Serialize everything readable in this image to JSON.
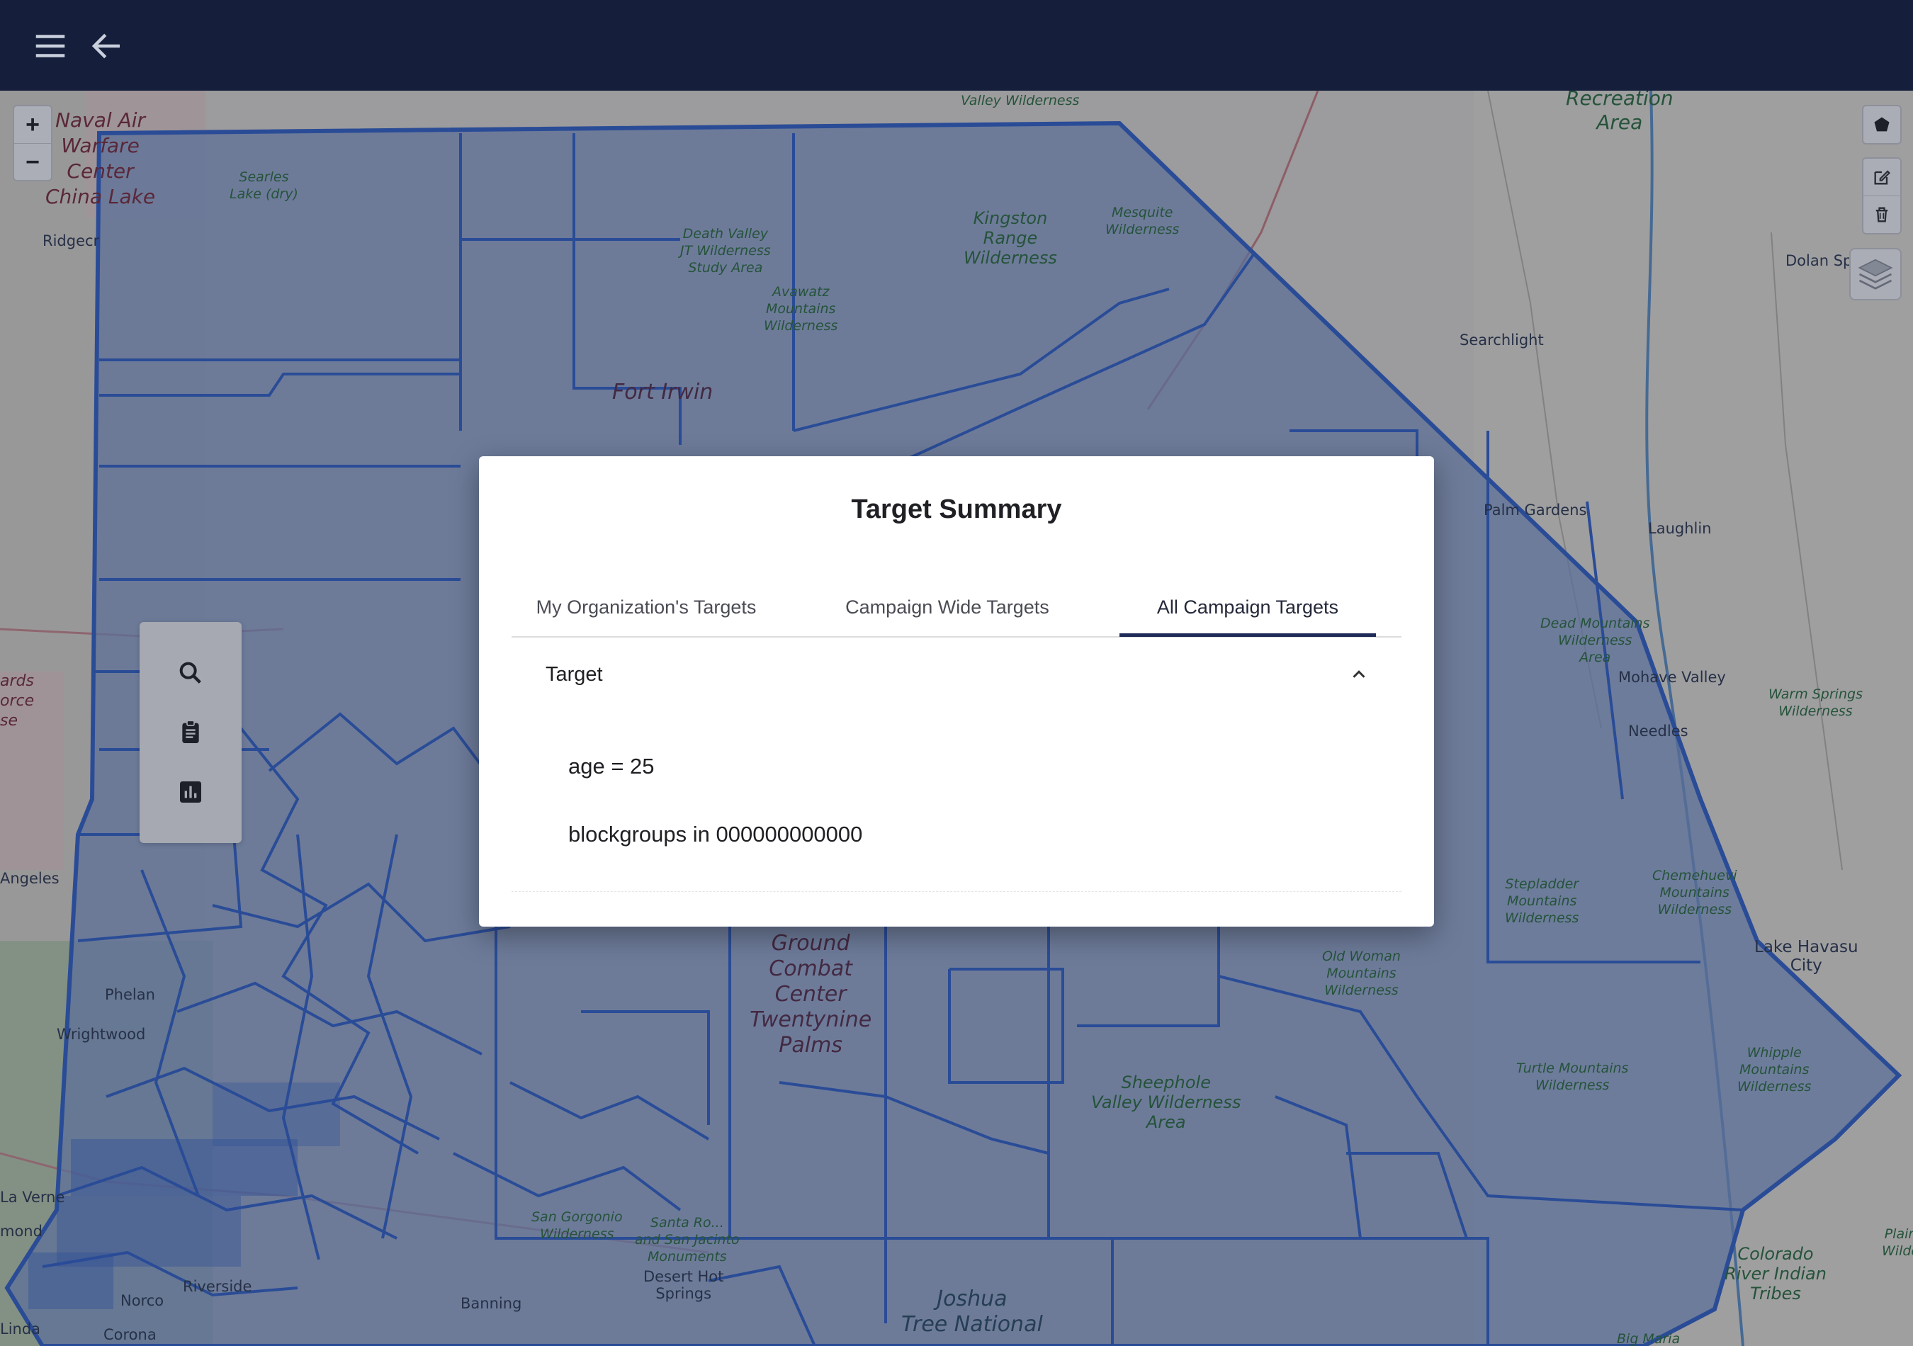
{
  "header": {
    "menu_icon": "menu-icon",
    "back_icon": "arrow-left-icon",
    "background": "#151f3b"
  },
  "map": {
    "labels": {
      "naval_air": "Naval Air\nWarfare\nCenter\nChina Lake",
      "searles": "Searles\nLake (dry)",
      "ridgecrest": "Ridgecr",
      "death_valley": "Death Valley\nJT Wilderness\nStudy Area",
      "avawatz": "Avawatz\nMountains\nWilderness",
      "kingston": "Kingston\nRange\nWilderness",
      "mesquite": "Mesquite\nWilderness",
      "valley_wilderness": "Valley Wilderness",
      "recreation_area": "Recreation\nArea",
      "fort_irwin": "Fort Irwin",
      "searchlight": "Searchlight",
      "dolan_springs": "Dolan Spr",
      "palm_gardens": "Palm Gardens",
      "laughlin": "Laughlin",
      "dead_mountains": "Dead Mountains\nWilderness\nArea",
      "mojave_valley": "Mohave Valley",
      "warm_springs": "Warm Springs\nWilderness",
      "needles": "Needles",
      "stepladder": "Stepladder\nMountains\nWilderness",
      "chemehuevi": "Chemehuevi\nMountains\nWilderness",
      "old_woman": "Old Woman\nMountains\nWilderness",
      "lake_havasu": "Lake Havasu\nCity",
      "ground_combat": "Ground\nCombat\nCenter\nTwentynine\nPalms",
      "turtle": "Turtle Mountains\nWilderness",
      "whipple": "Whipple\nMountains\nWilderness",
      "sheephole": "Sheephole\nValley Wilderness\nArea",
      "angeles": "Angeles",
      "rds_orce": "ards\norce\nse",
      "phelan": "Phelan",
      "wrightwood": "Wrightwood",
      "la_verne": "La Verne",
      "mond": "mond",
      "riverside": "Riverside",
      "norco": "Norco",
      "corona": "Corona",
      "linda": "Linda",
      "banning": "Banning",
      "desert_hot": "Desert Hot\nSprings",
      "san_gorgonio": "San Gorgonio\nWilderness",
      "santa_rosa": "Santa Ro...\nand San Jacinto\nMonuments",
      "joshua_tree": "Joshua\nTree National",
      "colorado_river": "Colorado\nRiver Indian\nTribes",
      "big_maria": "Big Maria",
      "plain": "Plain\nWilde"
    }
  },
  "map_controls": {
    "zoom_in": "+",
    "zoom_out": "−",
    "polygon_icon": "polygon-draw-icon",
    "edit_icon": "edit-icon",
    "delete_icon": "trash-icon",
    "layers_icon": "layers-icon"
  },
  "side_tools": {
    "search_icon": "search-icon",
    "clipboard_icon": "clipboard-icon",
    "chart_icon": "bar-chart-icon"
  },
  "modal": {
    "title": "Target Summary",
    "tabs": [
      {
        "label": "My Organization's Targets",
        "active": false
      },
      {
        "label": "Campaign Wide Targets",
        "active": false
      },
      {
        "label": "All Campaign Targets",
        "active": true
      }
    ],
    "section": {
      "title": "Target",
      "expanded": true,
      "criteria": [
        "age = 25",
        "blockgroups in 000000000000"
      ]
    }
  },
  "colors": {
    "region_fill": "#7d95c6",
    "region_stroke": "#3563c4",
    "accent": "#1e2b57"
  }
}
